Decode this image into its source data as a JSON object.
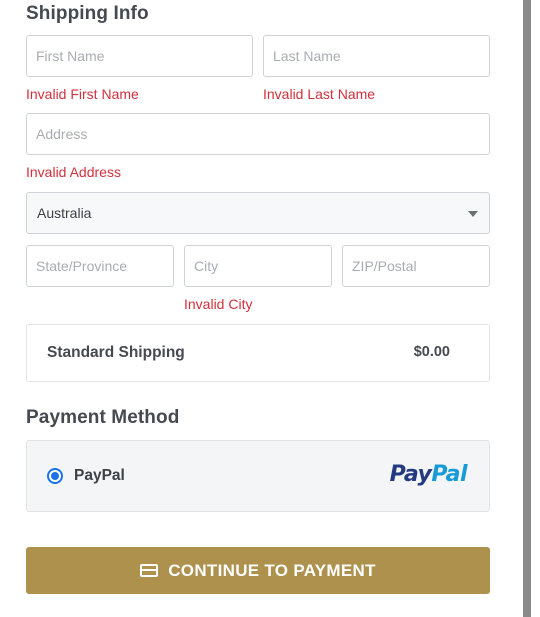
{
  "shipping": {
    "title": "Shipping Info",
    "first_name": {
      "placeholder": "First Name",
      "value": "",
      "error": "Invalid First Name"
    },
    "last_name": {
      "placeholder": "Last Name",
      "value": "",
      "error": "Invalid Last Name"
    },
    "address": {
      "placeholder": "Address",
      "value": "",
      "error": "Invalid Address"
    },
    "country": {
      "selected": "Australia"
    },
    "state": {
      "placeholder": "State/Province",
      "value": ""
    },
    "city": {
      "placeholder": "City",
      "value": "",
      "error": "Invalid City"
    },
    "zip": {
      "placeholder": "ZIP/Postal",
      "value": ""
    },
    "method": {
      "name": "Standard Shipping",
      "price": "$0.00"
    }
  },
  "payment": {
    "title": "Payment Method",
    "option": {
      "label": "PayPal",
      "selected": true,
      "logo_part1": "Pay",
      "logo_part2": "Pal"
    }
  },
  "cta": {
    "label": "CONTINUE TO PAYMENT",
    "icon": "credit-card-icon"
  },
  "colors": {
    "accent": "#ae914d",
    "error": "#d0313c",
    "radio": "#1a73e8",
    "paypal_dark": "#253b80",
    "paypal_light": "#179bd7"
  }
}
